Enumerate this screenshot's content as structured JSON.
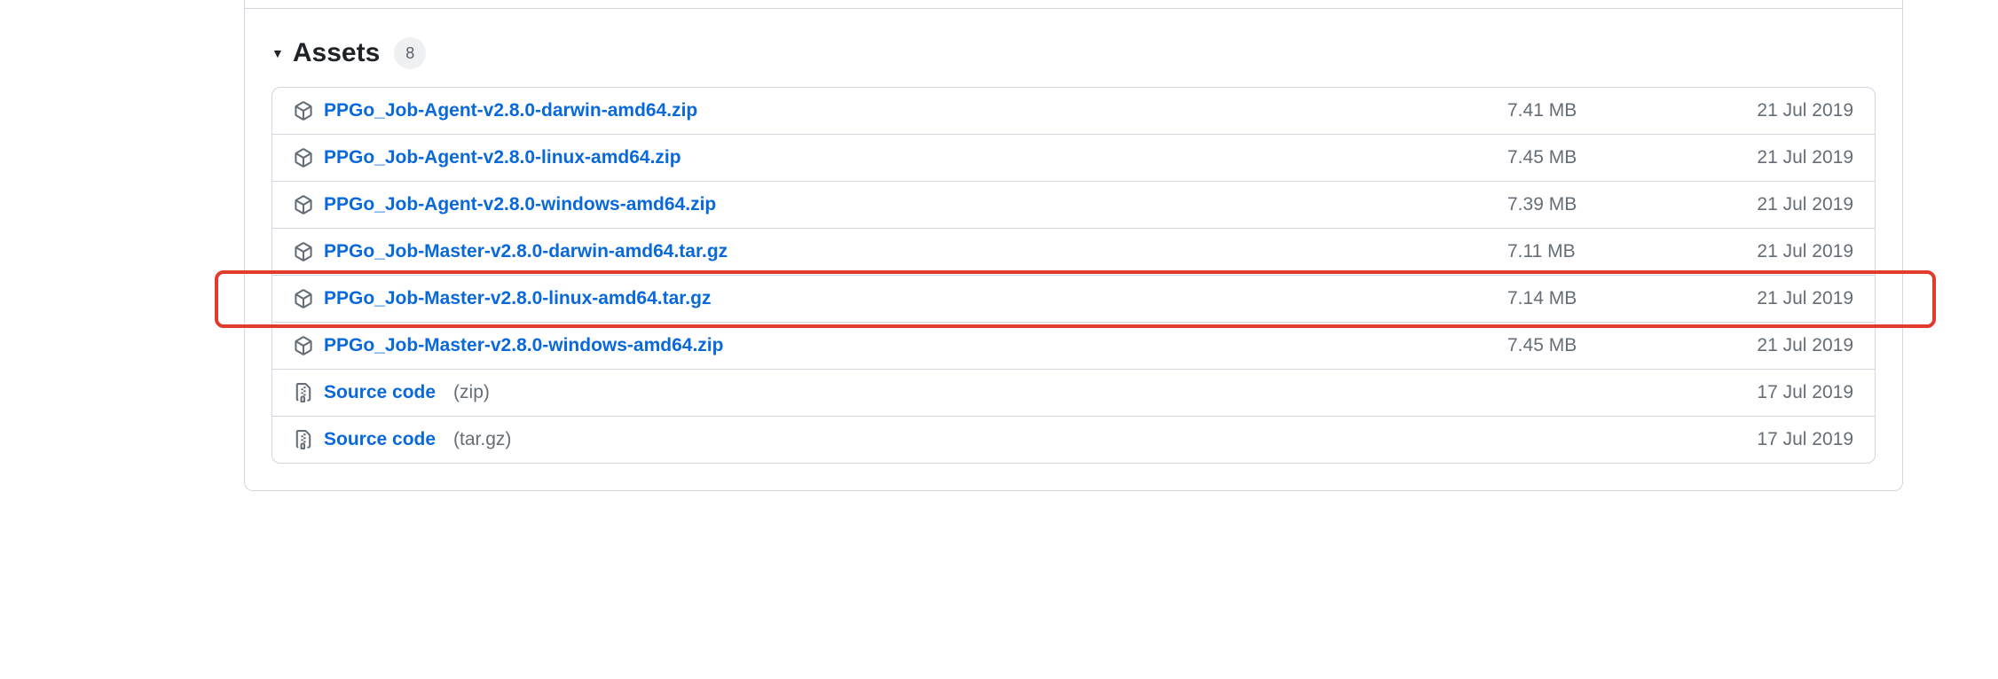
{
  "header": {
    "title": "Assets",
    "count": "8"
  },
  "assets": [
    {
      "type": "package",
      "name": "PPGo_Job-Agent-v2.8.0-darwin-amd64.zip",
      "format": "",
      "size": "7.41 MB",
      "date": "21 Jul 2019",
      "highlight": false
    },
    {
      "type": "package",
      "name": "PPGo_Job-Agent-v2.8.0-linux-amd64.zip",
      "format": "",
      "size": "7.45 MB",
      "date": "21 Jul 2019",
      "highlight": false
    },
    {
      "type": "package",
      "name": "PPGo_Job-Agent-v2.8.0-windows-amd64.zip",
      "format": "",
      "size": "7.39 MB",
      "date": "21 Jul 2019",
      "highlight": false
    },
    {
      "type": "package",
      "name": "PPGo_Job-Master-v2.8.0-darwin-amd64.tar.gz",
      "format": "",
      "size": "7.11 MB",
      "date": "21 Jul 2019",
      "highlight": false
    },
    {
      "type": "package",
      "name": "PPGo_Job-Master-v2.8.0-linux-amd64.tar.gz",
      "format": "",
      "size": "7.14 MB",
      "date": "21 Jul 2019",
      "highlight": true
    },
    {
      "type": "package",
      "name": "PPGo_Job-Master-v2.8.0-windows-amd64.zip",
      "format": "",
      "size": "7.45 MB",
      "date": "21 Jul 2019",
      "highlight": false
    },
    {
      "type": "zip",
      "name": "Source code",
      "format": "(zip)",
      "size": "",
      "date": "17 Jul 2019",
      "highlight": false
    },
    {
      "type": "zip",
      "name": "Source code",
      "format": "(tar.gz)",
      "size": "",
      "date": "17 Jul 2019",
      "highlight": false
    }
  ]
}
